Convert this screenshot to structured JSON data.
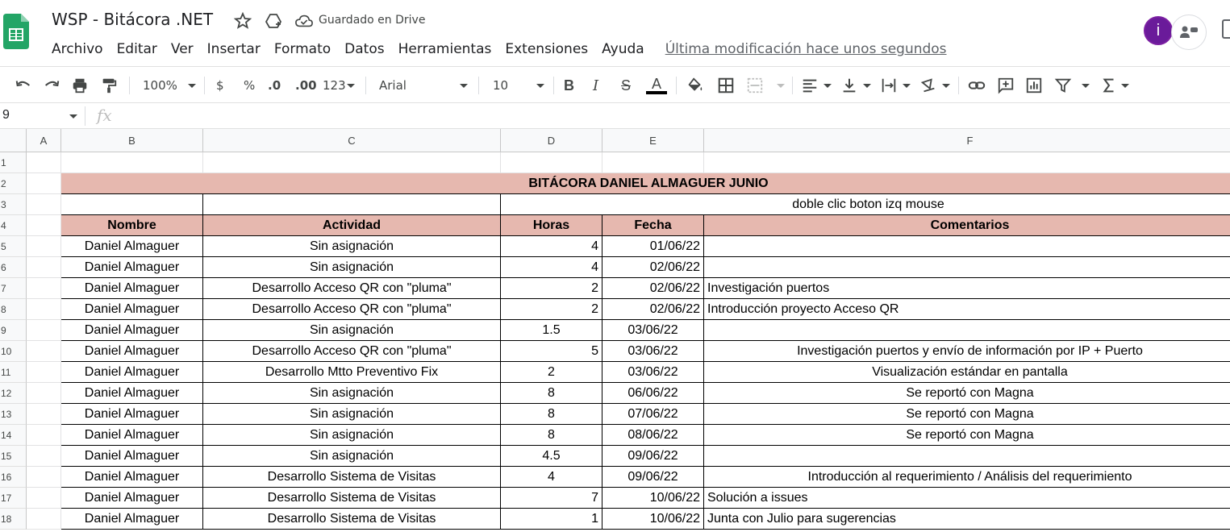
{
  "app": {
    "doc_title": "WSP - Bitácora .NET",
    "saved_status": "Guardado en Drive",
    "last_edit": "Última modificación hace unos segundos",
    "avatar_letter": "i",
    "menu": [
      "Archivo",
      "Editar",
      "Ver",
      "Insertar",
      "Formato",
      "Datos",
      "Herramientas",
      "Extensiones",
      "Ayuda"
    ]
  },
  "toolbar": {
    "zoom": "100%",
    "currency": "$",
    "percent": "%",
    "dec_decrease": ".0",
    "dec_increase": ".00",
    "number_format": "123",
    "font": "Arial",
    "font_size": "10",
    "bold": "B",
    "italic": "I",
    "strike": "S",
    "text_color_label": "A",
    "text_color": "#000000"
  },
  "formula_bar": {
    "name_box": "9",
    "fx": "fx"
  },
  "columns": [
    "A",
    "B",
    "C",
    "D",
    "E",
    "F"
  ],
  "row_numbers": [
    "1",
    "2",
    "3",
    "4",
    "5",
    "6",
    "7",
    "8",
    "9",
    "10",
    "11",
    "12",
    "13",
    "14",
    "15",
    "16",
    "17",
    "18"
  ],
  "sheet": {
    "title": "BITÁCORA DANIEL ALMAGUER JUNIO",
    "note": "doble clic boton izq mouse",
    "headers": [
      "Nombre",
      "Actividad",
      "Horas",
      "Fecha",
      "Comentarios"
    ],
    "header_color": "#e6b8af",
    "rows": [
      {
        "nombre": "Daniel Almaguer",
        "actividad": "Sin asignación",
        "horas": "4",
        "fecha": "01/06/22",
        "comentarios": ""
      },
      {
        "nombre": "Daniel Almaguer",
        "actividad": "Sin asignación",
        "horas": "4",
        "fecha": "02/06/22",
        "comentarios": ""
      },
      {
        "nombre": "Daniel Almaguer",
        "actividad": "Desarrollo Acceso QR con \"pluma\"",
        "horas": "2",
        "fecha": "02/06/22",
        "comentarios": "Investigación puertos"
      },
      {
        "nombre": "Daniel Almaguer",
        "actividad": "Desarrollo Acceso QR con \"pluma\"",
        "horas": "2",
        "fecha": "02/06/22",
        "comentarios": "Introducción proyecto Acceso QR"
      },
      {
        "nombre": "Daniel Almaguer",
        "actividad": "Sin asignación",
        "horas": "1.5",
        "fecha": "03/06/22",
        "comentarios": ""
      },
      {
        "nombre": "Daniel Almaguer",
        "actividad": "Desarrollo Acceso QR con \"pluma\"",
        "horas": "5",
        "fecha": "03/06/22",
        "comentarios": "Investigación puertos y envío de información por IP + Puerto"
      },
      {
        "nombre": "Daniel Almaguer",
        "actividad": "Desarrollo Mtto Preventivo Fix",
        "horas": "2",
        "fecha": "03/06/22",
        "comentarios": "Visualización estándar en pantalla"
      },
      {
        "nombre": "Daniel Almaguer",
        "actividad": "Sin asignación",
        "horas": "8",
        "fecha": "06/06/22",
        "comentarios": "Se reportó con Magna"
      },
      {
        "nombre": "Daniel Almaguer",
        "actividad": "Sin asignación",
        "horas": "8",
        "fecha": "07/06/22",
        "comentarios": "Se reportó con Magna"
      },
      {
        "nombre": "Daniel Almaguer",
        "actividad": "Sin asignación",
        "horas": "8",
        "fecha": "08/06/22",
        "comentarios": "Se reportó con Magna"
      },
      {
        "nombre": "Daniel Almaguer",
        "actividad": "Sin asignación",
        "horas": "4.5",
        "fecha": "09/06/22",
        "comentarios": ""
      },
      {
        "nombre": "Daniel Almaguer",
        "actividad": "Desarrollo Sistema de Visitas",
        "horas": "4",
        "fecha": "09/06/22",
        "comentarios": "Introducción al requerimiento / Análisis del requerimiento"
      },
      {
        "nombre": "Daniel Almaguer",
        "actividad": "Desarrollo Sistema de Visitas",
        "horas": "7",
        "fecha": "10/06/22",
        "comentarios": "Solución a issues"
      },
      {
        "nombre": "Daniel Almaguer",
        "actividad": "Desarrollo Sistema de Visitas",
        "horas": "1",
        "fecha": "10/06/22",
        "comentarios": "Junta con Julio para sugerencias"
      }
    ]
  }
}
